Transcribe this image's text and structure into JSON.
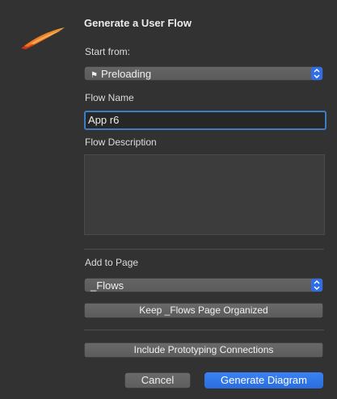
{
  "dialog": {
    "title": "Generate a User Flow"
  },
  "start_from": {
    "label": "Start from:",
    "icon": "flag-icon",
    "selected": "Preloading"
  },
  "flow_name": {
    "label": "Flow Name",
    "value": "App r6"
  },
  "flow_description": {
    "label": "Flow Description",
    "value": ""
  },
  "add_to_page": {
    "label": "Add to Page",
    "selected": "_Flows",
    "organize_button": "Keep _Flows Page Organized"
  },
  "prototyping_button": "Include Prototyping Connections",
  "footer": {
    "cancel": "Cancel",
    "generate": "Generate Diagram"
  },
  "colors": {
    "accent": "#2f6ee8",
    "background": "#323232",
    "focus_ring": "#3a7fc6"
  }
}
